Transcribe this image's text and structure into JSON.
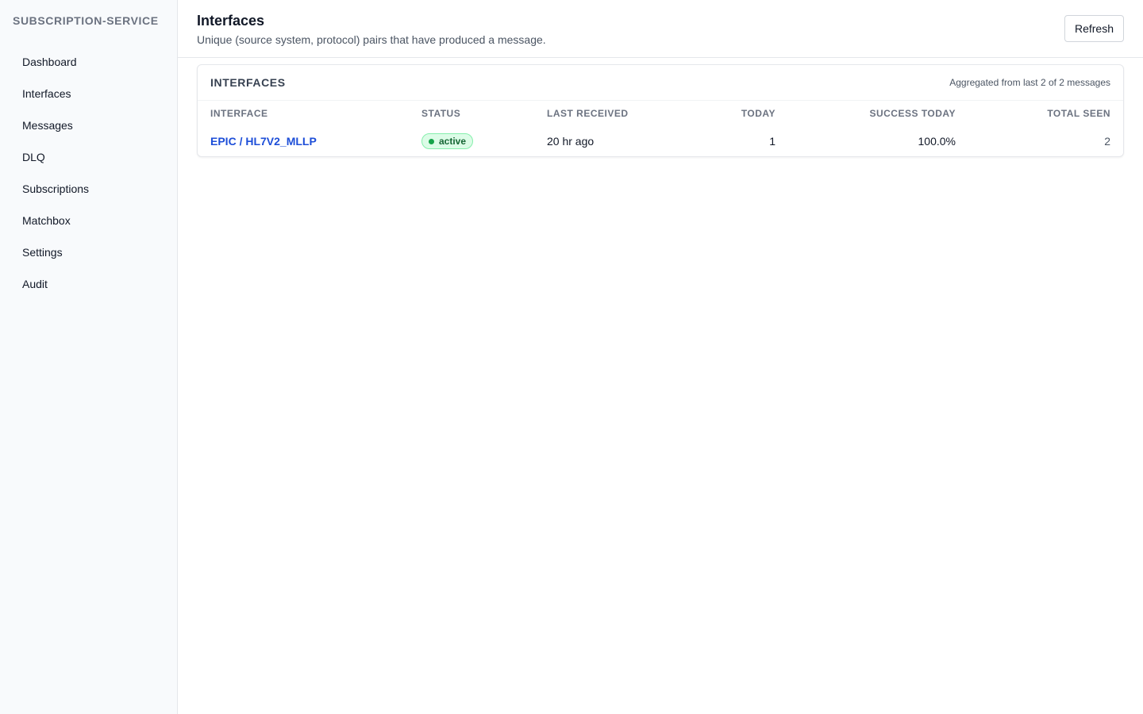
{
  "sidebar": {
    "brand": "SUBSCRIPTION-SERVICE",
    "items": [
      {
        "label": "Dashboard"
      },
      {
        "label": "Interfaces"
      },
      {
        "label": "Messages"
      },
      {
        "label": "DLQ"
      },
      {
        "label": "Subscriptions"
      },
      {
        "label": "Matchbox"
      },
      {
        "label": "Settings"
      },
      {
        "label": "Audit"
      }
    ]
  },
  "header": {
    "title": "Interfaces",
    "subtitle": "Unique (source system, protocol) pairs that have produced a message.",
    "refresh_label": "Refresh"
  },
  "card": {
    "title": "INTERFACES",
    "meta": "Aggregated from last 2 of 2 messages"
  },
  "table": {
    "columns": [
      "INTERFACE",
      "STATUS",
      "LAST RECEIVED",
      "TODAY",
      "SUCCESS TODAY",
      "TOTAL SEEN"
    ],
    "rows": [
      {
        "interface": "EPIC / HL7V2_MLLP",
        "status": "active",
        "last_received": "20 hr ago",
        "today": "1",
        "success_today": "100.0%",
        "total_seen": "2"
      }
    ]
  },
  "colors": {
    "link": "#1d4ed8",
    "status_active_bg": "#dcfce7",
    "status_active_text": "#166534",
    "status_active_dot": "#16a34a"
  }
}
